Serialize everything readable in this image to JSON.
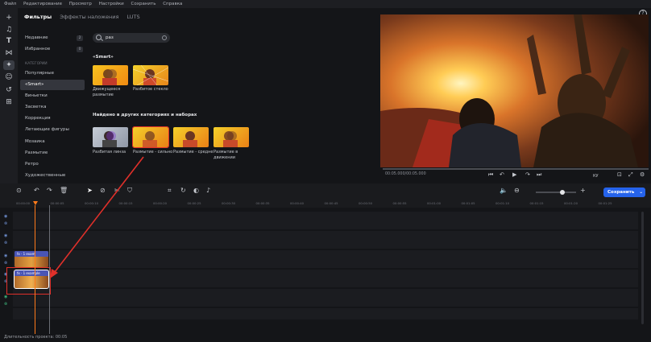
{
  "menu": [
    "Файл",
    "Редактирование",
    "Просмотр",
    "Настройки",
    "Сохранить",
    "Справка"
  ],
  "tabs": [
    {
      "label": "Фильтры",
      "active": true
    },
    {
      "label": "Эффекты наложения",
      "active": false
    },
    {
      "label": "LUTS",
      "active": false
    }
  ],
  "categories_top": [
    {
      "label": "Недавние",
      "count": "2"
    },
    {
      "label": "Избранное",
      "count": "0"
    }
  ],
  "section_label": "КАТЕГОРИИ",
  "categories": [
    {
      "label": "Популярные",
      "active": false
    },
    {
      "label": "«Smart»",
      "active": true
    },
    {
      "label": "Виньетки",
      "active": false
    },
    {
      "label": "Засветка",
      "active": false
    },
    {
      "label": "Коррекция",
      "active": false
    },
    {
      "label": "Летающие фигуры",
      "active": false
    },
    {
      "label": "Мозаика",
      "active": false
    },
    {
      "label": "Размытие",
      "active": false
    },
    {
      "label": "Ретро",
      "active": false
    },
    {
      "label": "Художественные",
      "active": false
    }
  ],
  "search": {
    "value": "раз",
    "placeholder": "Поиск"
  },
  "smart_heading": "«Smart»",
  "smart_filters": [
    {
      "label": "Движущееся размытие"
    },
    {
      "label": "Разбитое стекло"
    }
  ],
  "other_heading": "Найдено в других категориях и наборах",
  "other_filters": [
    {
      "label": "Разбитая линза"
    },
    {
      "label": "Размытие - сильно"
    },
    {
      "label": "Размытие - средне"
    },
    {
      "label": "Размытие в движении"
    }
  ],
  "player": {
    "time": "00:05.000/00:05.000",
    "quality": "КУ"
  },
  "timeline": {
    "save_label": "Сохранить",
    "ruler": [
      "00:00:00",
      "00:00:05",
      "00:00:10",
      "00:00:15",
      "00:00:20",
      "00:00:25",
      "00:00:30",
      "00:00:35",
      "00:00:40",
      "00:00:45",
      "00:00:50",
      "00:00:55",
      "00:01:00",
      "00:01:05",
      "00:01:10",
      "00:01:15",
      "00:01:20",
      "00:01:25"
    ],
    "clip_label_top": "fx · 1   exam",
    "clip_label_selected": "fx · 1   example",
    "project_duration": "Длительность проекта: 00:05"
  },
  "colors": {
    "accent": "#2563eb",
    "annotation": "#e0302a",
    "playhead": "#ff7a1a"
  }
}
